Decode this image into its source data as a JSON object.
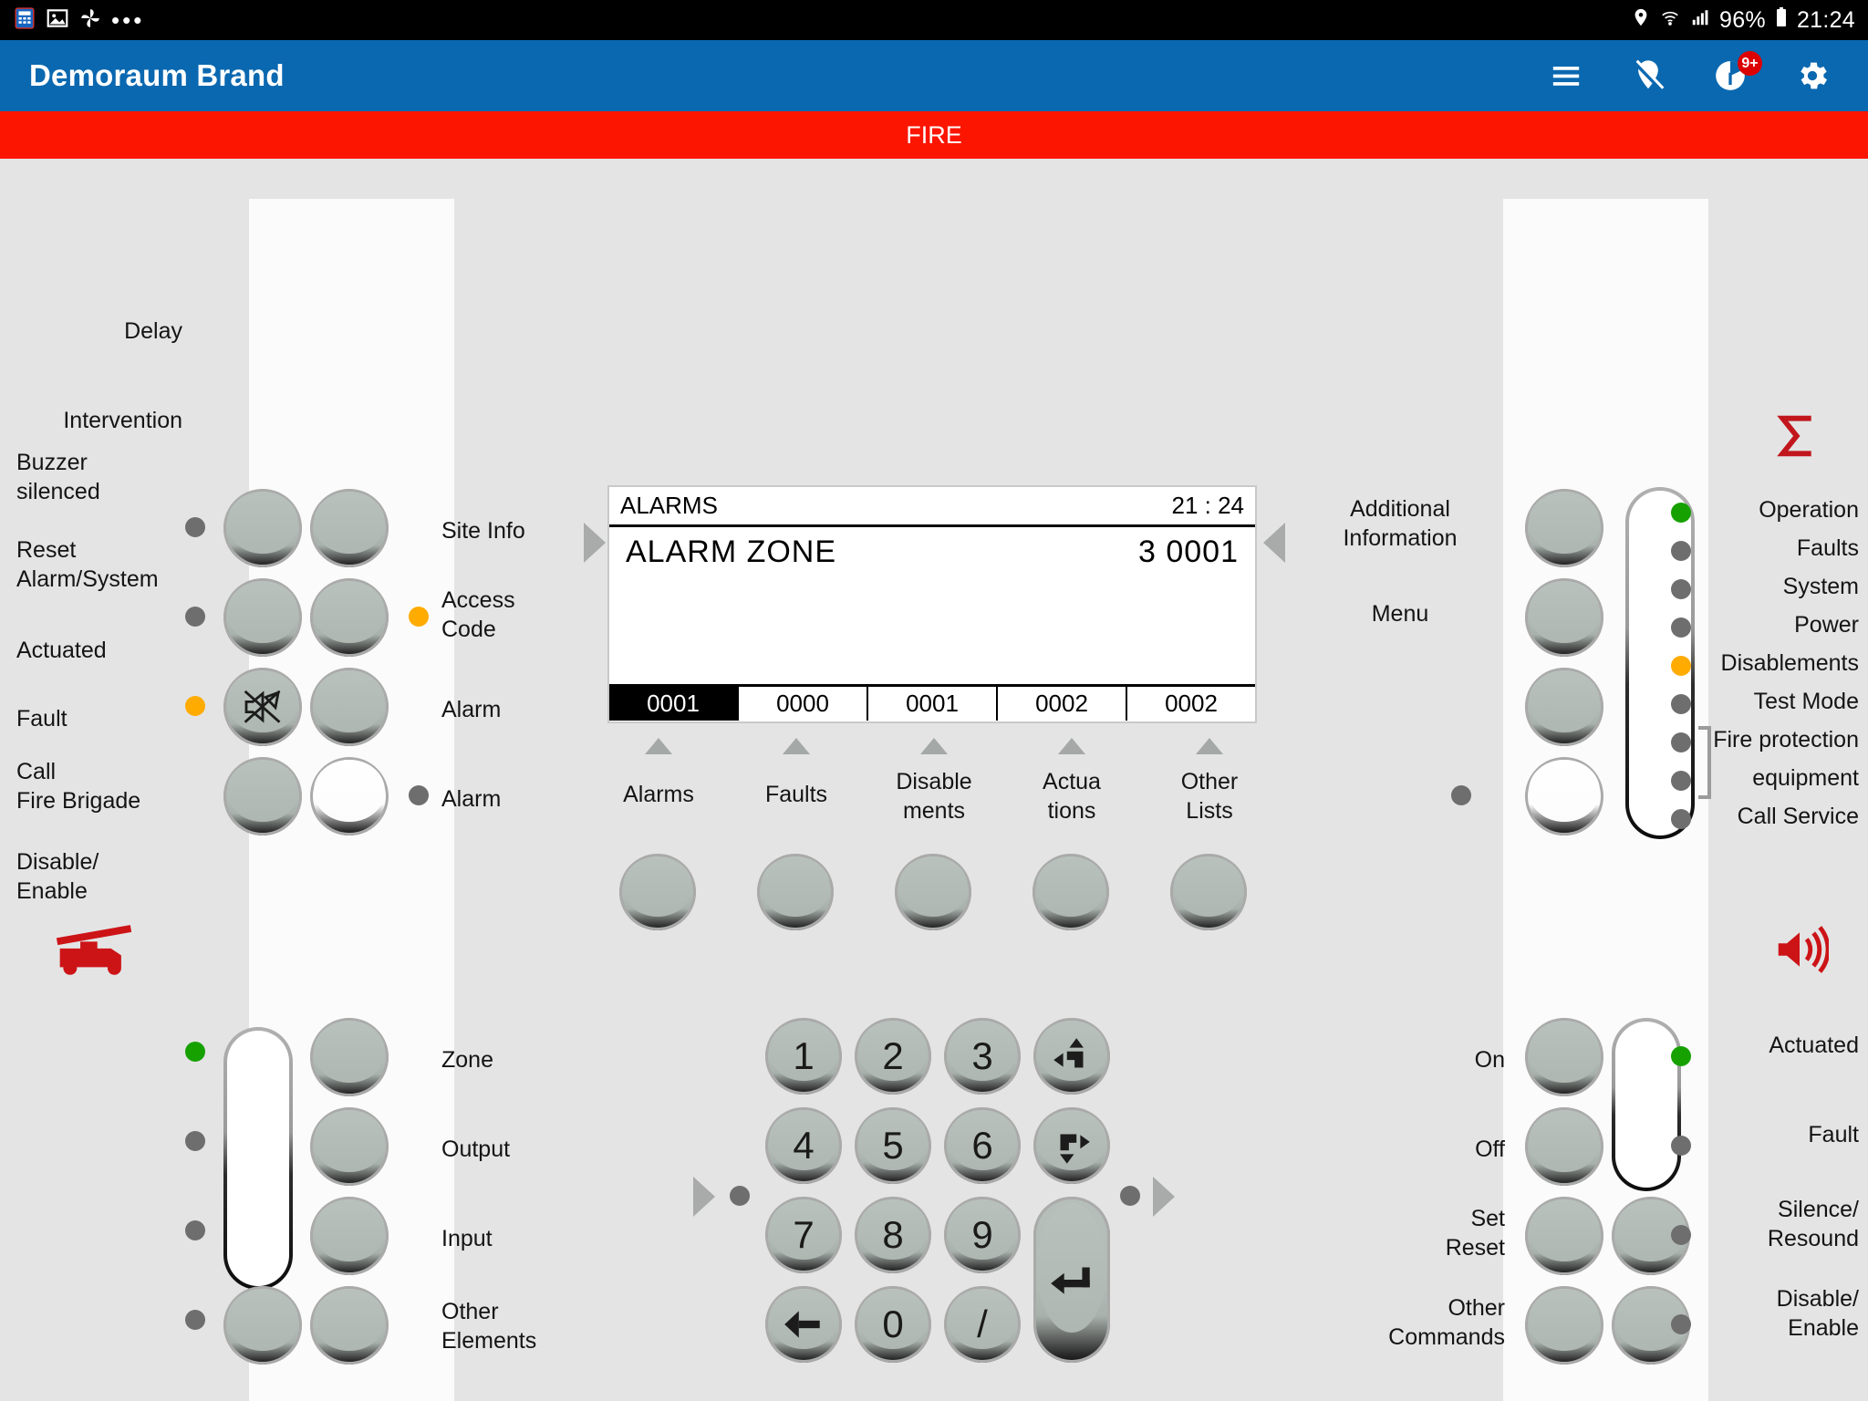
{
  "statusbar": {
    "left_icons": [
      "calculator-icon",
      "image-icon",
      "pinwheel-icon",
      "more-dots-icon"
    ],
    "location_icon": "location-pin-icon",
    "wifi_icon": "wifi-icon",
    "signal_icon": "cell-signal-icon",
    "battery_text": "96%",
    "battery_icon": "battery-icon",
    "clock": "21:24"
  },
  "appbar": {
    "title": "Demoraum Brand",
    "icons": [
      {
        "name": "hamburger-menu-icon",
        "label": "Menu"
      },
      {
        "name": "location-off-icon",
        "label": "Location off"
      },
      {
        "name": "notifications-icon",
        "label": "Notifications",
        "badge": "9+"
      },
      {
        "name": "settings-gear-icon",
        "label": "Settings"
      }
    ]
  },
  "banner": {
    "text": "FIRE",
    "color": "#fc1500"
  },
  "lcd": {
    "header_title": "ALARMS",
    "header_time": "21 : 24",
    "line_label": "ALARM  ZONE",
    "line_value": "3 0001",
    "tabs": [
      {
        "value": "0001",
        "active": true
      },
      {
        "value": "0000",
        "active": false
      },
      {
        "value": "0001",
        "active": false
      },
      {
        "value": "0002",
        "active": false
      },
      {
        "value": "0002",
        "active": false
      }
    ]
  },
  "list_buttons": [
    {
      "label": "Alarms"
    },
    {
      "label": "Faults"
    },
    {
      "label": "Disable\nments"
    },
    {
      "label": "Actua\ntions"
    },
    {
      "label": "Other\nLists"
    }
  ],
  "top_left": {
    "rows": [
      {
        "label": "Delay",
        "led": "off"
      },
      {
        "label": "Intervention",
        "led": "off"
      },
      {
        "label": "Buzzer\nsilenced",
        "led": "amber"
      },
      {
        "label": "Reset\nAlarm/System",
        "led": "none"
      }
    ],
    "right_labels": [
      {
        "label": "Site Info",
        "led": "none"
      },
      {
        "label": "Access\nCode",
        "led": "amber"
      },
      {
        "label": "Alarm",
        "led": "none"
      },
      {
        "label": "Alarm",
        "led": "off"
      }
    ],
    "buzzer_icon": "buzzer-muted-icon"
  },
  "bottom_left": {
    "icon": "fire-truck-icon",
    "icon_color": "#cc1417",
    "rows": [
      {
        "label": "Actuated",
        "led": "green"
      },
      {
        "label": "Fault",
        "led": "off"
      },
      {
        "label": "Call\nFire Brigade",
        "led": "off"
      },
      {
        "label": "Disable/\nEnable",
        "led": "off"
      }
    ],
    "right_labels": [
      "Zone",
      "Output",
      "Input",
      "Other\nElements"
    ]
  },
  "top_right": {
    "icon": "sigma-icon",
    "icon_color": "#c1161c",
    "left_labels": [
      "Additional\nInformation",
      "Menu"
    ],
    "leds": [
      {
        "label": "Operation",
        "state": "green"
      },
      {
        "label": "Faults",
        "state": "off"
      },
      {
        "label": "System",
        "state": "off"
      },
      {
        "label": "Power",
        "state": "off"
      },
      {
        "label": "Disablements",
        "state": "amber"
      },
      {
        "label": "Test Mode",
        "state": "off"
      },
      {
        "label": "Fire protection",
        "state": "off"
      },
      {
        "label": "equipment",
        "state": "off"
      },
      {
        "label": "Call Service",
        "state": "off"
      }
    ]
  },
  "bottom_right": {
    "icon": "speaker-icon",
    "icon_color": "#cc1417",
    "left_labels": [
      "On",
      "Off",
      "Set\nReset",
      "Other\nCommands"
    ],
    "right_rows": [
      {
        "label": "Actuated",
        "led": "green"
      },
      {
        "label": "Fault",
        "led": "off"
      },
      {
        "label": "Silence/\nResound",
        "led": "off"
      },
      {
        "label": "Disable/\nEnable",
        "led": "off"
      }
    ]
  },
  "keypad": {
    "keys": [
      {
        "label": "1",
        "name": "key-1"
      },
      {
        "label": "2",
        "name": "key-2"
      },
      {
        "label": "3",
        "name": "key-3"
      },
      {
        "label": "",
        "name": "key-nav-up-left",
        "glyph": "nav-up-left-icon"
      },
      {
        "label": "4",
        "name": "key-4"
      },
      {
        "label": "5",
        "name": "key-5"
      },
      {
        "label": "6",
        "name": "key-6"
      },
      {
        "label": "",
        "name": "key-nav-down-right",
        "glyph": "nav-down-right-icon"
      },
      {
        "label": "7",
        "name": "key-7"
      },
      {
        "label": "8",
        "name": "key-8"
      },
      {
        "label": "9",
        "name": "key-9"
      },
      {
        "label": "",
        "name": "key-backspace",
        "glyph": "backspace-icon"
      },
      {
        "label": "0",
        "name": "key-0"
      },
      {
        "label": "/",
        "name": "key-slash"
      }
    ],
    "enter_glyph": "enter-icon"
  }
}
